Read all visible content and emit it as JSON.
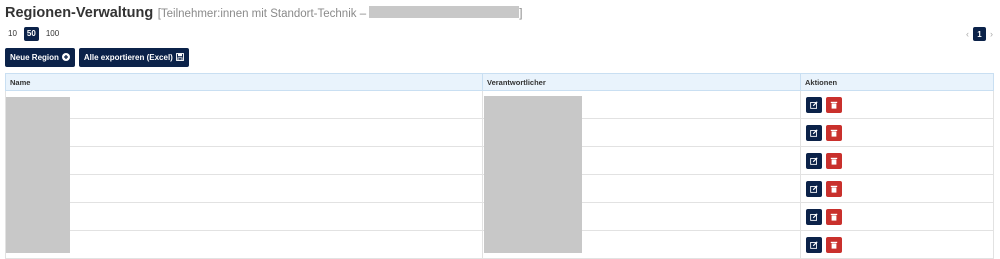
{
  "header": {
    "title": "Regionen-Verwaltung",
    "subtitle_prefix": "[Teilnehmer:innen mit Standort-Technik –",
    "subtitle_suffix": "]"
  },
  "page_sizes": [
    {
      "label": "10",
      "active": false
    },
    {
      "label": "50",
      "active": true
    },
    {
      "label": "100",
      "active": false
    }
  ],
  "pagination": {
    "prev": "‹",
    "current": "1",
    "next": "›"
  },
  "toolbar": {
    "new_region_label": "Neue Region",
    "export_label": "Alle exportieren (Excel)"
  },
  "table": {
    "columns": [
      "Name",
      "Verantwortlicher",
      "Aktionen"
    ],
    "row_count": 6
  },
  "colors": {
    "primary": "#0b2249",
    "danger": "#c9302c",
    "header_bg": "#e9f3fc",
    "redacted": "#c8c8c8"
  },
  "icons": {
    "new_region": "plus-circle-icon",
    "export": "save-icon",
    "edit": "edit-icon",
    "delete": "trash-icon"
  }
}
